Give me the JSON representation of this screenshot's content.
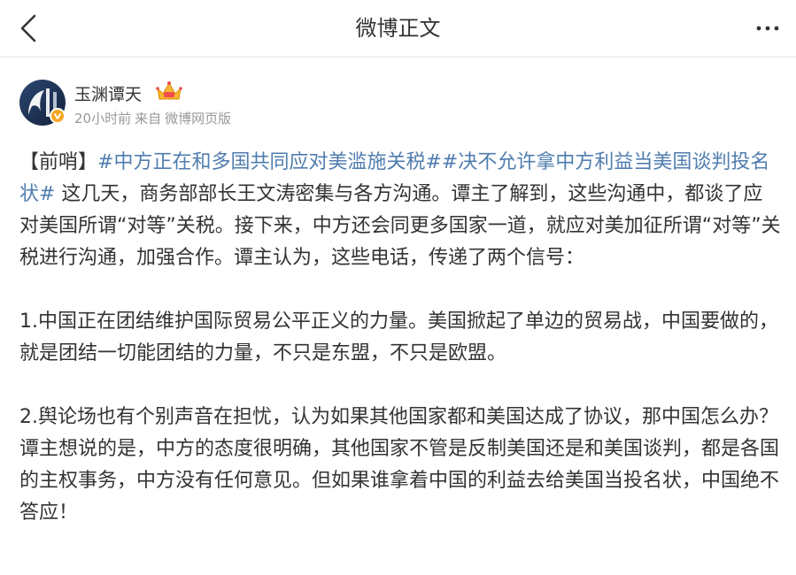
{
  "header": {
    "title": "微博正文",
    "back_icon": "chevron-left-icon",
    "more_icon": "more-horizontal-icon"
  },
  "post": {
    "author": "玉渊谭天",
    "time": "20小时前",
    "source_prefix": "来自",
    "source": "微博网页版",
    "intro_prefix": "【前哨】",
    "hashtag_1": "#中方正在和多国共同应对美滥施关税#",
    "hashtag_2": "#决不允许拿中方利益当美国谈判投名状#",
    "intro_text": " 这几天，商务部部长王文涛密集与各方沟通。谭主了解到，这些沟通中，都谈了应对美国所谓“对等”关税。接下来，中方还会同更多国家一道，就应对美加征所谓“对等”关税进行沟通，加强合作。谭主认为，这些电话，传递了两个信号：",
    "point_1": "1.中国正在团结维护国际贸易公平正义的力量。美国掀起了单边的贸易战，中国要做的，就是团结一切能团结的力量，不只是东盟，不只是欧盟。",
    "point_2": "2.舆论场也有个别声音在担忧，认为如果其他国家都和美国达成了协议，那中国怎么办？谭主想说的是，中方的态度很明确，其他国家不管是反制美国还是和美国谈判，都是各国的主权事务，中方没有任何意见。但如果谁拿着中国的利益去给美国当投名状，中国绝不答应！"
  },
  "colors": {
    "hashtag": "#507daf",
    "meta": "#999999",
    "text": "#333333",
    "verified": "#f5a623"
  }
}
